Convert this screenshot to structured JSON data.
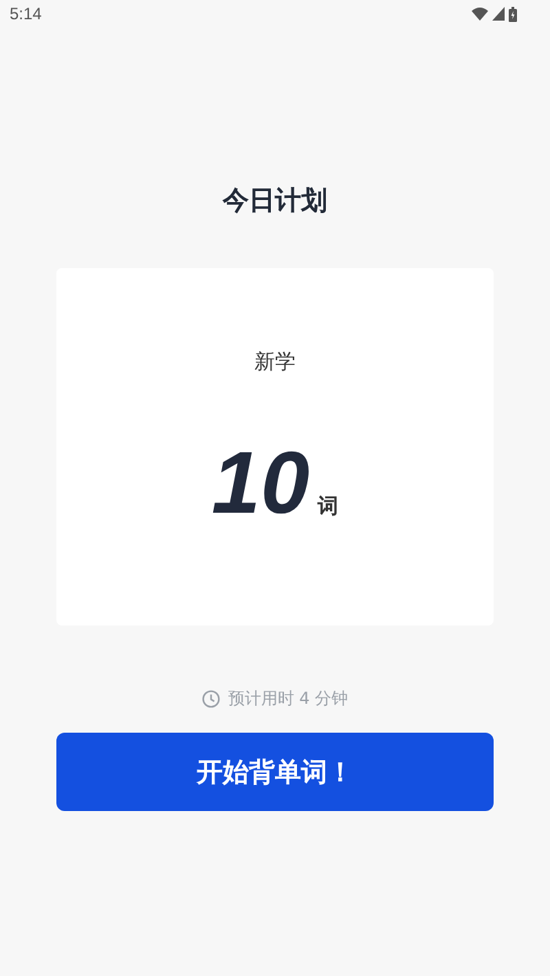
{
  "status_bar": {
    "time": "5:14"
  },
  "title": "今日计划",
  "plan_card": {
    "label": "新学",
    "count": "10",
    "unit": "词"
  },
  "estimate": "预计用时 4 分钟",
  "start_button": "开始背单词！"
}
